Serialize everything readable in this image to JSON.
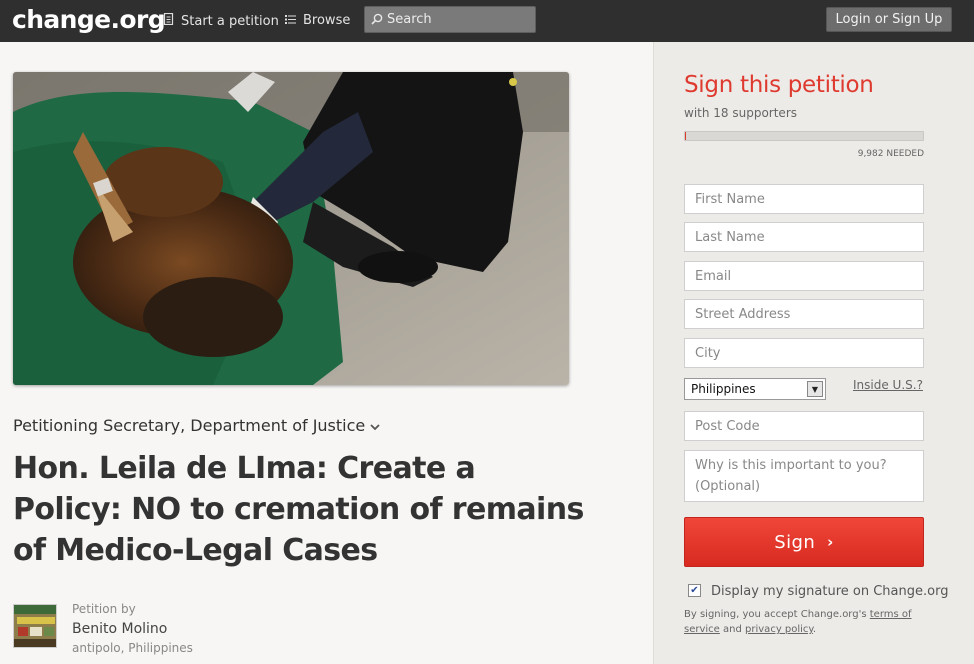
{
  "nav": {
    "logo": "change.org",
    "start_petition": "Start a petition",
    "browse": "Browse",
    "search_placeholder": "Search",
    "login": "Login or Sign Up"
  },
  "petition": {
    "petitioning": "Petitioning Secretary, Department of Justice",
    "title": "Hon. Leila de LIma: Create a Policy: NO to cremation of remains of Medico-Legal Cases",
    "by_label": "Petition by",
    "author": "Benito Molino",
    "location": "antipolo, Philippines"
  },
  "sign": {
    "title": "Sign this petition",
    "supporters": "with 18 supporters",
    "progress": 0.0018,
    "needed": "9,982 NEEDED",
    "fields": {
      "first_name": "First Name",
      "last_name": "Last Name",
      "email": "Email",
      "street": "Street Address",
      "city": "City",
      "post_code": "Post Code",
      "why": "Why is this important to you? (Optional)"
    },
    "country": "Philippines",
    "inside_us": "Inside U.S.?",
    "button": "Sign",
    "display_signature": "Display my signature on Change.org",
    "legal_prefix": "By signing, you accept Change.org's",
    "terms": "terms of service",
    "legal_and": "and",
    "privacy": "privacy policy",
    "legal_end": "."
  },
  "colors": {
    "accent": "#df3a2f",
    "topbar": "#2f2f2f"
  }
}
